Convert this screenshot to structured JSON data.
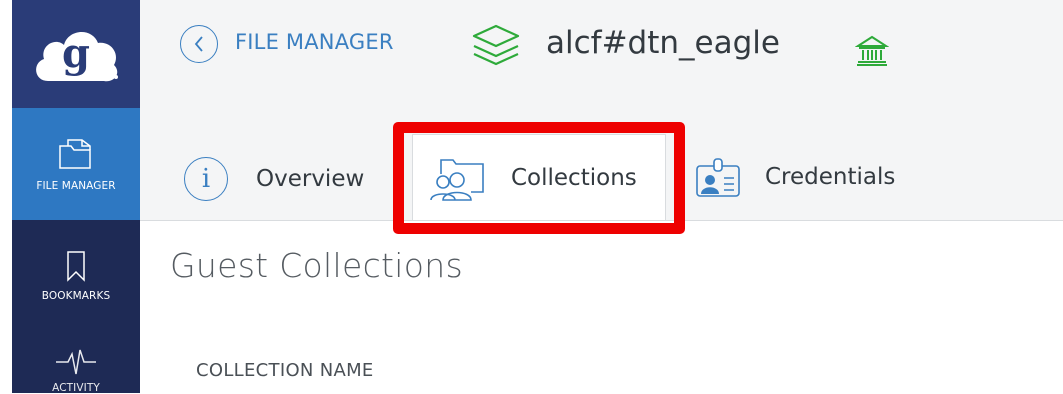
{
  "sidebar": {
    "logo_letter": "g",
    "items": [
      {
        "label": "FILE MANAGER",
        "icon": "folder-icon",
        "active": true
      },
      {
        "label": "BOOKMARKS",
        "icon": "bookmark-icon",
        "active": false
      },
      {
        "label": "ACTIVITY",
        "icon": "activity-icon",
        "active": false
      }
    ]
  },
  "header": {
    "back_link": "FILE MANAGER",
    "endpoint_name": "alcf#dtn_eagle",
    "endpoint_icon": "layers-icon",
    "institution_icon": "bank-icon"
  },
  "tabs": [
    {
      "label": "Overview",
      "icon": "info-icon"
    },
    {
      "label": "Collections",
      "icon": "collections-icon",
      "active": true
    },
    {
      "label": "Credentials",
      "icon": "id-card-icon"
    }
  ],
  "content": {
    "section_title": "Guest Collections",
    "column_header": "COLLECTION NAME"
  },
  "colors": {
    "sidebar_bg": "#1e2a55",
    "sidebar_active": "#2e78c2",
    "link_blue": "#3a7fc1",
    "green": "#2eaa3a",
    "highlight_red": "#ee0000"
  }
}
